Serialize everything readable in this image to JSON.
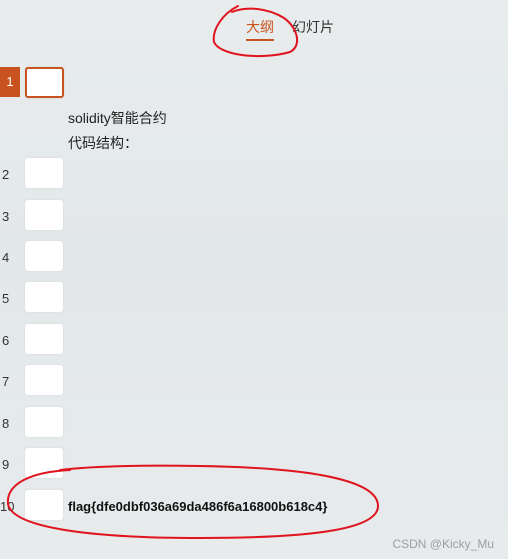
{
  "tabs": {
    "outline": "大纲",
    "slides": "幻灯片"
  },
  "slides": [
    {
      "number": "1",
      "lines": [
        "solidity智能合约",
        "代码结构："
      ]
    },
    {
      "number": "2"
    },
    {
      "number": "3"
    },
    {
      "number": "4"
    },
    {
      "number": "5"
    },
    {
      "number": "6"
    },
    {
      "number": "7"
    },
    {
      "number": "8"
    },
    {
      "number": "9"
    },
    {
      "number": "10",
      "flag": "flag{dfe0dbf036a69da486f6a16800b618c4}"
    }
  ],
  "watermark": "CSDN @Kicky_Mu",
  "colors": {
    "accent": "#c9531e",
    "annotation": "#e0141e"
  }
}
